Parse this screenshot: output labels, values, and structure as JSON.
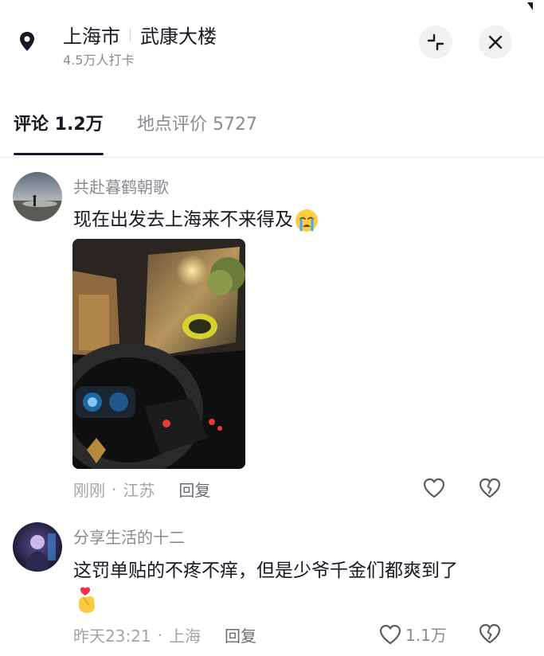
{
  "header": {
    "city": "上海市",
    "building": "武康大楼",
    "checkins": "4.5万人打卡",
    "icons": {
      "pin": "location-pin-icon",
      "collapse": "collapse-icon",
      "close": "close-icon"
    }
  },
  "tabs": [
    {
      "label": "评论 1.2万",
      "active": true
    },
    {
      "label": "地点评价 5727",
      "active": false
    }
  ],
  "comments": [
    {
      "username": "共赴暮鹤朝歌",
      "text": "现在出发去上海来不来得及",
      "emoji": "crying-face-emoji",
      "has_photo": true,
      "time": "刚刚",
      "location": "江苏",
      "reply_label": "回复",
      "like_count": ""
    },
    {
      "username": "分享生活的十二",
      "text": "这罚单贴的不疼不痒，但是少爷千金们都爽到了",
      "emoji": "finger-heart-emoji",
      "has_photo": false,
      "time": "昨天23:21",
      "location": "上海",
      "reply_label": "回复",
      "like_count": "1.1万"
    }
  ],
  "colors": {
    "text": "#161823",
    "secondary": "#8a8b91",
    "divider": "#ececee"
  }
}
